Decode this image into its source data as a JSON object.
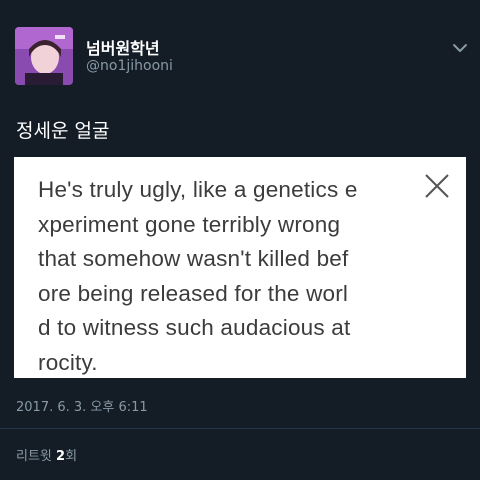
{
  "author": {
    "display_name": "넘버원학년",
    "handle": "@no1jihooni",
    "avatar_icon": "user-avatar"
  },
  "tweet": {
    "text": "정세운 얼굴",
    "timestamp": "2017. 6. 3. 오후 6:11"
  },
  "overlay": {
    "lines": [
      "He's truly ugly, like a genetics e",
      "xperiment gone terribly wrong",
      "that somehow wasn't killed bef",
      "ore being released for the worl",
      "d to witness such audacious at",
      "rocity."
    ],
    "close_icon": "close-icon"
  },
  "stats": {
    "retweets_label": "리트윗",
    "retweets_count": "2",
    "retweets_suffix": "회"
  },
  "colors": {
    "background": "#141d26",
    "secondary_text": "#8899a6",
    "card_background": "#ffffff",
    "card_text": "#3c3c3c"
  }
}
